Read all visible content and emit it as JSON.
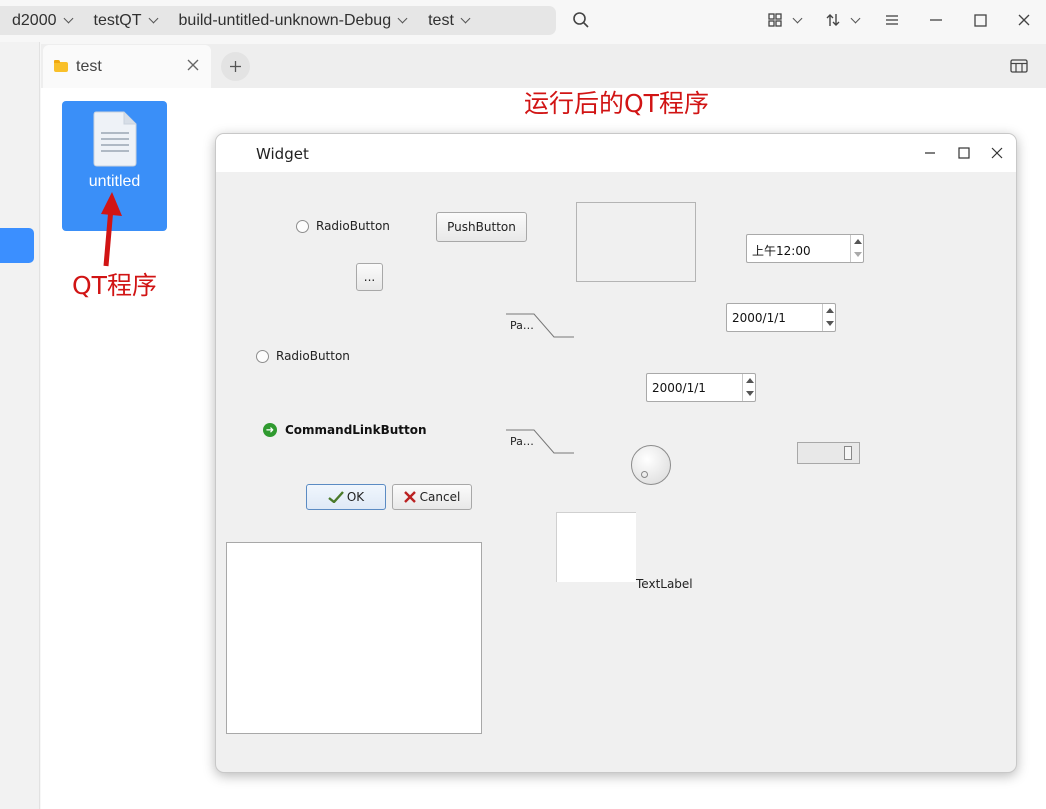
{
  "breadcrumbs": [
    {
      "label": "d2000"
    },
    {
      "label": "testQT"
    },
    {
      "label": "build-untitled-unknown-Debug"
    },
    {
      "label": "test"
    }
  ],
  "toolbar": {
    "search_icon": "search-icon",
    "view_icon": "grid-view-icon",
    "sort_icon": "sort-icon",
    "menu_icon": "menu-icon"
  },
  "tabs": [
    {
      "label": "test",
      "icon": "folder-icon"
    }
  ],
  "file": {
    "name": "untitled",
    "icon": "text-document-icon"
  },
  "annotations": {
    "title": "运行后的QT程序",
    "pointer_label": "QT程序",
    "color": "#d11414"
  },
  "qt_window": {
    "title": "Widget",
    "radio_top": "RadioButton",
    "radio_left": "RadioButton",
    "push_button": "PushButton",
    "tool_button": "...",
    "time_edit": "上午12:00",
    "date_edit_1": "2000/1/1",
    "date_edit_2": "2000/1/1",
    "toolbox_page_1": "Pa…",
    "toolbox_page_2": "Pa…",
    "command_link": "CommandLinkButton",
    "ok_button": "OK",
    "cancel_button": "Cancel",
    "text_label": "TextLabel"
  },
  "colors": {
    "accent": "#3b8fff",
    "file_tile": "#3a8ff8",
    "folder": "#f9c02a"
  }
}
